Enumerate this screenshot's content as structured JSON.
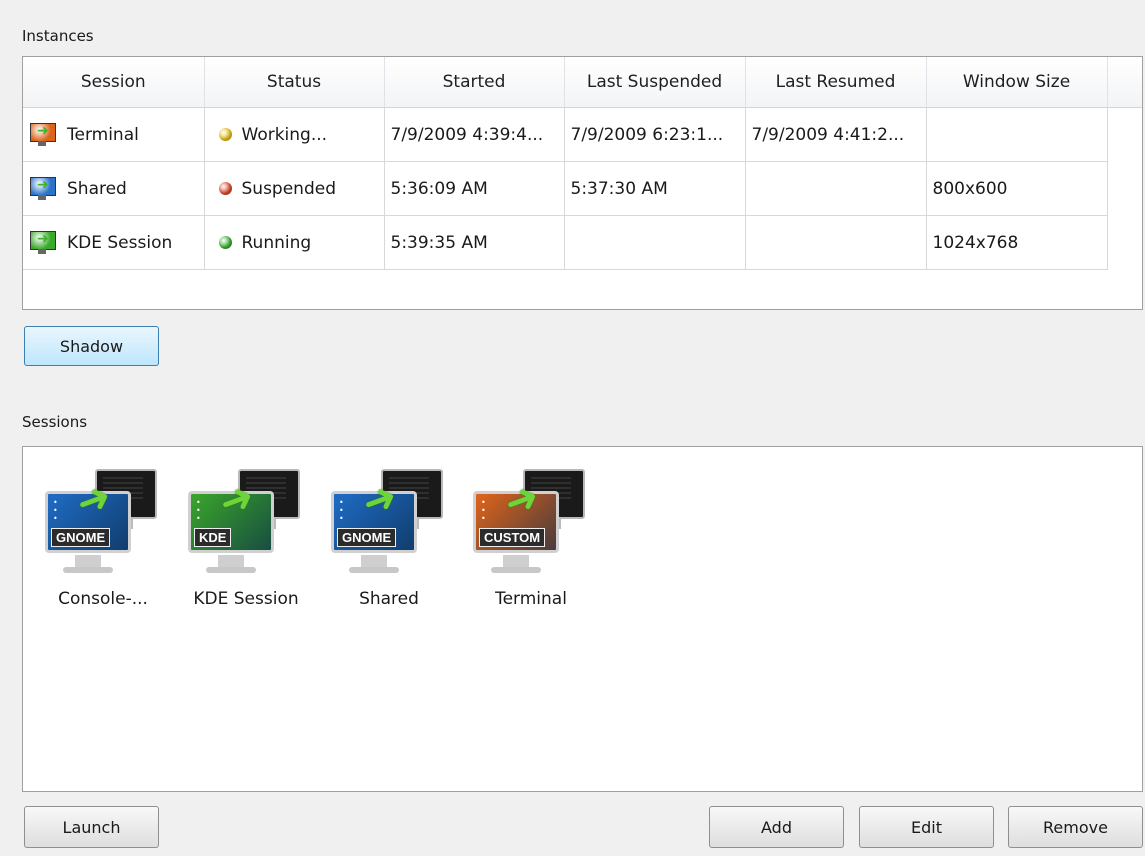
{
  "labels": {
    "instances": "Instances",
    "sessions": "Sessions"
  },
  "instances": {
    "columns": [
      "Session",
      "Status",
      "Started",
      "Last Suspended",
      "Last Resumed",
      "Window Size"
    ],
    "rows": [
      {
        "session": "Terminal",
        "status": "Working...",
        "status_color": "#e8c21a",
        "started": "7/9/2009 4:39:4...",
        "last_suspended": "7/9/2009 6:23:1...",
        "last_resumed": "7/9/2009 4:41:2...",
        "window_size": "",
        "icon_color": "#d9641a"
      },
      {
        "session": "Shared",
        "status": "Suspended",
        "status_color": "#e04a28",
        "started": "5:36:09 AM",
        "last_suspended": "5:37:30 AM",
        "last_resumed": "",
        "window_size": "800x600",
        "icon_color": "#2a73c9"
      },
      {
        "session": "KDE Session",
        "status": "Running",
        "status_color": "#3cb22f",
        "started": "5:39:35 AM",
        "last_suspended": "",
        "last_resumed": "",
        "window_size": "1024x768",
        "icon_color": "#39a92a"
      }
    ]
  },
  "buttons": {
    "shadow": "Shadow",
    "launch": "Launch",
    "add": "Add",
    "edit": "Edit",
    "remove": "Remove"
  },
  "sessions": [
    {
      "name": "Console-...",
      "badge": "GNOME",
      "color": "#1f6cc5",
      "icon": "gnome-session-icon"
    },
    {
      "name": "KDE Session",
      "badge": "KDE",
      "color": "#3aa62a",
      "icon": "kde-session-icon"
    },
    {
      "name": "Shared",
      "badge": "GNOME",
      "color": "#1f6cc5",
      "icon": "gnome-session-icon"
    },
    {
      "name": "Terminal",
      "badge": "CUSTOM",
      "color": "#e0651b",
      "icon": "custom-session-icon"
    }
  ]
}
